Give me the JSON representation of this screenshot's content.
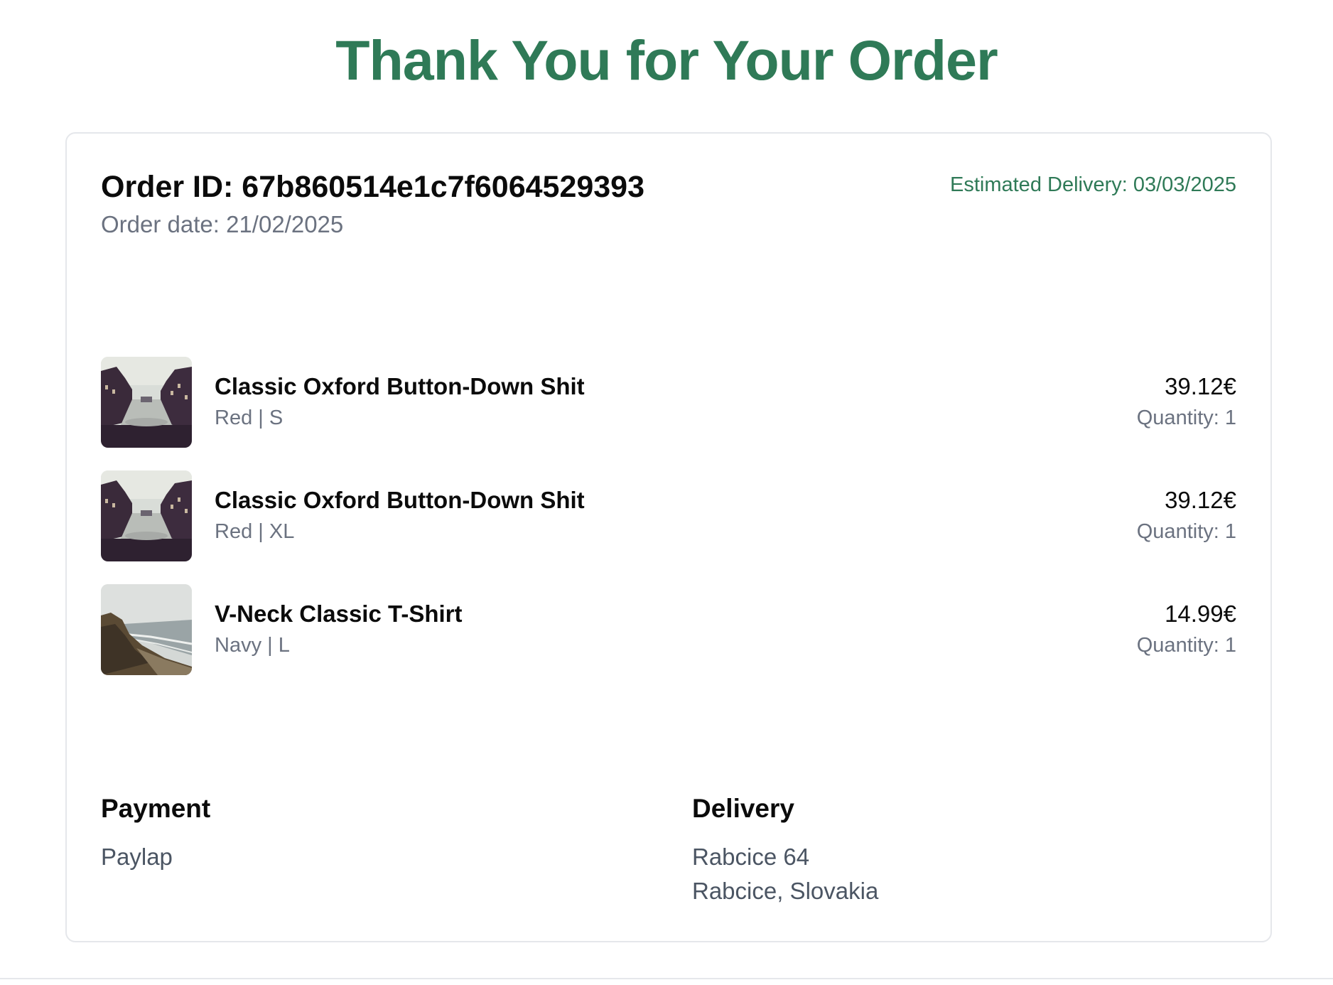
{
  "page": {
    "title": "Thank You for Your Order"
  },
  "order": {
    "id_label": "Order ID: 67b860514e1c7f6064529393",
    "date_label": "Order date: 21/02/2025",
    "estimated_delivery_label": "Estimated Delivery: 03/03/2025"
  },
  "items": [
    {
      "name": "Classic Oxford Button-Down Shit",
      "variant": "Red | S",
      "price": "39.12€",
      "quantity": "Quantity: 1",
      "image": "canal-photo"
    },
    {
      "name": "Classic Oxford Button-Down Shit",
      "variant": "Red | XL",
      "price": "39.12€",
      "quantity": "Quantity: 1",
      "image": "canal-photo"
    },
    {
      "name": "V-Neck Classic T-Shirt",
      "variant": "Navy | L",
      "price": "14.99€",
      "quantity": "Quantity: 1",
      "image": "coastline-photo"
    }
  ],
  "payment": {
    "heading": "Payment",
    "method": "Paylap"
  },
  "delivery": {
    "heading": "Delivery",
    "address_line1": "Rabcice 64",
    "address_line2": "Rabcice, Slovakia"
  },
  "colors": {
    "accent": "#2f7a57",
    "muted_text": "#6b7280",
    "border": "#e5e7eb"
  }
}
